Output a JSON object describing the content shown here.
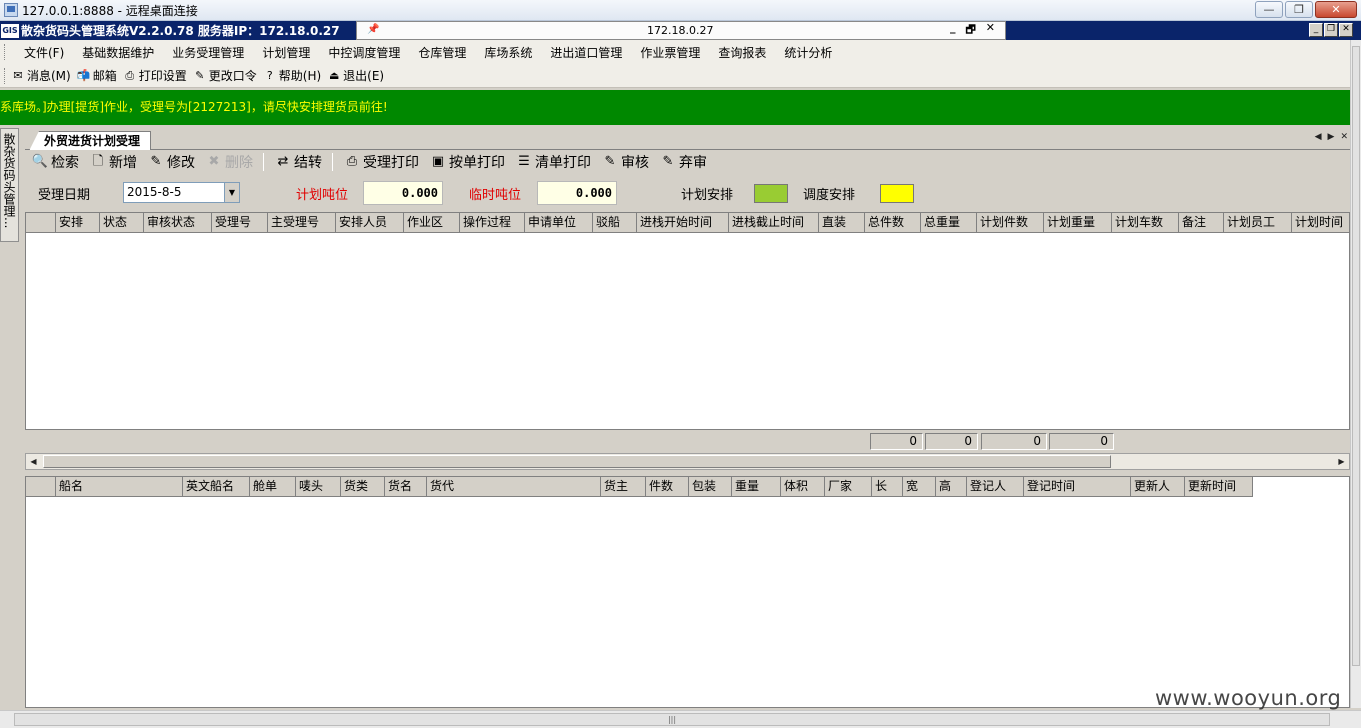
{
  "window": {
    "title": "127.0.0.1:8888 - 远程桌面连接",
    "minimize": "—",
    "restore": "❐",
    "close": "✕"
  },
  "app": {
    "logo_text": "GIS",
    "title": "散杂货码头管理系统V2.2.0.78 服务器IP：172.18.0.27",
    "rdp_ip": "172.18.0.27",
    "rdp_min": "_",
    "rdp_restore": "🗗",
    "rdp_close": "✕"
  },
  "menu": [
    "文件(F)",
    "基础数据维护",
    "业务受理管理",
    "计划管理",
    "中控调度管理",
    "仓库管理",
    "库场系统",
    "进出道口管理",
    "作业票管理",
    "查询报表",
    "统计分析"
  ],
  "toolbar": [
    {
      "label": "消息(M)",
      "icon": "message-icon",
      "glyph": "✉"
    },
    {
      "label": "邮箱",
      "icon": "mailbox-icon",
      "glyph": "📬"
    },
    {
      "label": "打印设置",
      "icon": "printer-icon",
      "glyph": "⎙"
    },
    {
      "label": "更改口令",
      "icon": "password-icon",
      "glyph": "✎"
    },
    {
      "label": "帮助(H)",
      "icon": "help-icon",
      "glyph": "?"
    },
    {
      "label": "退出(E)",
      "icon": "exit-icon",
      "glyph": "⏏"
    }
  ],
  "marquee": "系库场。]办理[提货]作业，受理号为[2127213]，请尽快安排理货员前往!",
  "sidetab": "散杂货码头管理...",
  "tab": {
    "label": "外贸进货计划受理"
  },
  "actions": [
    {
      "label": "检索",
      "icon": "search-icon",
      "glyph": "🔍",
      "enabled": true
    },
    {
      "label": "新增",
      "icon": "new-document-icon",
      "glyph": "🗋",
      "enabled": true
    },
    {
      "label": "修改",
      "icon": "edit-icon",
      "glyph": "✎",
      "enabled": true
    },
    {
      "label": "删除",
      "icon": "delete-icon",
      "glyph": "✖",
      "enabled": false
    },
    {
      "label": "结转",
      "icon": "carry-over-icon",
      "glyph": "⇄",
      "enabled": true
    },
    {
      "label": "受理打印",
      "icon": "printer-icon",
      "glyph": "⎙",
      "enabled": true
    },
    {
      "label": "按单打印",
      "icon": "print-by-order-icon",
      "glyph": "▣",
      "enabled": true
    },
    {
      "label": "清单打印",
      "icon": "list-print-icon",
      "glyph": "☰",
      "enabled": true
    },
    {
      "label": "审核",
      "icon": "approve-icon",
      "glyph": "✎",
      "enabled": true
    },
    {
      "label": "弃审",
      "icon": "unapprove-icon",
      "glyph": "✎",
      "enabled": true
    }
  ],
  "filters": {
    "date_label": "受理日期",
    "date_value": "2015-8-5",
    "plan_tonnage_label": "计划吨位",
    "plan_tonnage_value": "0.000",
    "temp_tonnage_label": "临时吨位",
    "temp_tonnage_value": "0.000",
    "plan_arrange_label": "计划安排",
    "dispatch_arrange_label": "调度安排",
    "plan_color": "#99cc33",
    "dispatch_color": "#ffff00"
  },
  "grid1": {
    "columns": [
      "",
      "安排",
      "状态",
      "审核状态",
      "受理号",
      "主受理号",
      "安排人员",
      "作业区",
      "操作过程",
      "申请单位",
      "驳船",
      "进栈开始时间",
      "进栈截止时间",
      "直装",
      "总件数",
      "总重量",
      "计划件数",
      "计划重量",
      "计划车数",
      "备注",
      "计划员工",
      "计划时间"
    ],
    "totals": [
      "0",
      "0",
      "0",
      "0"
    ]
  },
  "grid2": {
    "columns": [
      "",
      "船名",
      "英文船名",
      "舱单",
      "唛头",
      "货类",
      "货名",
      "货代",
      "货主",
      "件数",
      "包装",
      "重量",
      "体积",
      "厂家",
      "长",
      "宽",
      "高",
      "登记人",
      "登记时间",
      "更新人",
      "更新时间"
    ]
  },
  "watermark": "www.wooyun.org"
}
